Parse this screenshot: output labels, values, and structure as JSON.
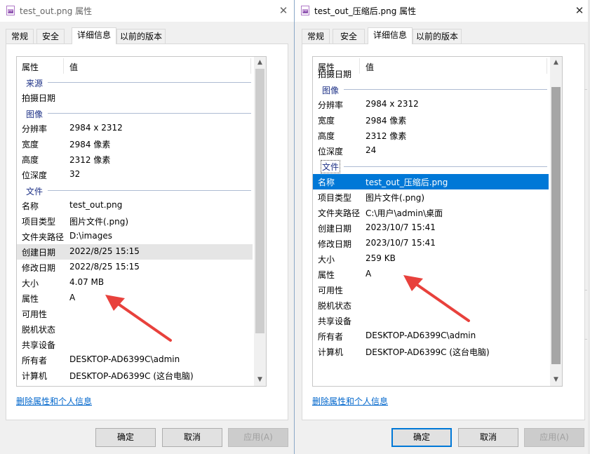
{
  "windows": [
    {
      "title": "test_out.png 属性",
      "close": "✕",
      "tabs": [
        "常规",
        "安全",
        "详细信息",
        "以前的版本"
      ],
      "active_tab": "详细信息",
      "columns": {
        "property": "属性",
        "value": "值"
      },
      "rows": [
        {
          "type": "group",
          "label": "来源"
        },
        {
          "key": "拍摄日期",
          "value": ""
        },
        {
          "type": "group",
          "label": "图像"
        },
        {
          "key": "分辨率",
          "value": "2984 x 2312"
        },
        {
          "key": "宽度",
          "value": "2984 像素"
        },
        {
          "key": "高度",
          "value": "2312 像素"
        },
        {
          "key": "位深度",
          "value": "32"
        },
        {
          "type": "group",
          "label": "文件"
        },
        {
          "key": "名称",
          "value": "test_out.png"
        },
        {
          "key": "项目类型",
          "value": "图片文件(.png)"
        },
        {
          "key": "文件夹路径",
          "value": "D:\\images"
        },
        {
          "key": "创建日期",
          "value": "2022/8/25 15:15",
          "highlight": true
        },
        {
          "key": "修改日期",
          "value": "2022/8/25 15:15"
        },
        {
          "key": "大小",
          "value": "4.07 MB"
        },
        {
          "key": "属性",
          "value": "A"
        },
        {
          "key": "可用性",
          "value": ""
        },
        {
          "key": "脱机状态",
          "value": ""
        },
        {
          "key": "共享设备",
          "value": ""
        },
        {
          "key": "所有者",
          "value": "DESKTOP-AD6399C\\admin"
        },
        {
          "key": "计算机",
          "value": "DESKTOP-AD6399C (这台电脑)"
        }
      ],
      "link": "删除属性和个人信息",
      "buttons": {
        "ok": "确定",
        "cancel": "取消",
        "apply": "应用(A)"
      }
    },
    {
      "title": "test_out_压缩后.png 属性",
      "close": "✕",
      "tabs": [
        "常规",
        "安全",
        "详细信息",
        "以前的版本"
      ],
      "active_tab": "详细信息",
      "columns": {
        "property": "属性",
        "value": "值"
      },
      "rows": [
        {
          "key": "拍摄日期",
          "value": "",
          "clipped": true
        },
        {
          "type": "group",
          "label": "图像"
        },
        {
          "key": "分辨率",
          "value": "2984 x 2312"
        },
        {
          "key": "宽度",
          "value": "2984 像素"
        },
        {
          "key": "高度",
          "value": "2312 像素"
        },
        {
          "key": "位深度",
          "value": "24"
        },
        {
          "type": "group",
          "label": "文件",
          "focus": true
        },
        {
          "key": "名称",
          "value": "test_out_压缩后.png",
          "selected": true
        },
        {
          "key": "项目类型",
          "value": "图片文件(.png)"
        },
        {
          "key": "文件夹路径",
          "value": "C:\\用户\\admin\\桌面"
        },
        {
          "key": "创建日期",
          "value": "2023/10/7 15:41"
        },
        {
          "key": "修改日期",
          "value": "2023/10/7 15:41"
        },
        {
          "key": "大小",
          "value": "259 KB"
        },
        {
          "key": "属性",
          "value": "A"
        },
        {
          "key": "可用性",
          "value": ""
        },
        {
          "key": "脱机状态",
          "value": ""
        },
        {
          "key": "共享设备",
          "value": ""
        },
        {
          "key": "所有者",
          "value": "DESKTOP-AD6399C\\admin"
        },
        {
          "key": "计算机",
          "value": "DESKTOP-AD6399C (这台电脑)"
        }
      ],
      "link": "删除属性和个人信息",
      "buttons": {
        "ok": "确定",
        "cancel": "取消",
        "apply": "应用(A)"
      }
    }
  ],
  "colors": {
    "selection": "#0078d7",
    "link": "#0066cc",
    "group_label": "#1e3287",
    "arrow": "#e8413c"
  },
  "icons": [
    "png-file-icon",
    "close-icon",
    "scroll-up-icon",
    "scroll-down-icon",
    "annotation-arrow"
  ]
}
